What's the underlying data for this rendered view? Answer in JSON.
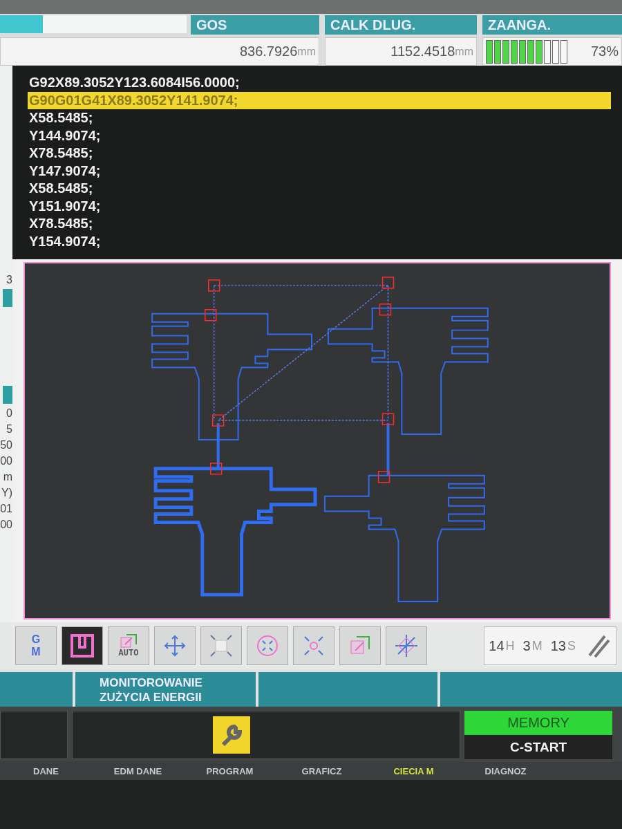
{
  "header": {
    "progress": {
      "level": 0.23
    },
    "panels": [
      {
        "title": "GOS",
        "value": "836.7926",
        "unit": "mm"
      },
      {
        "title": "CALK DLUG.",
        "value": "1152.4518",
        "unit": "mm"
      },
      {
        "title": "ZAANGA.",
        "meter": {
          "level": 0.7
        },
        "value": "73%"
      }
    ]
  },
  "left_strip": [
    "3",
    "0",
    "5",
    "50",
    "00",
    "m",
    "Y)",
    "01",
    "00"
  ],
  "program_lines": [
    {
      "text": "G92X89.3052Y123.6084I56.0000;",
      "selected": false
    },
    {
      "text": "G90G01G41X89.3052Y141.9074;",
      "selected": true
    },
    {
      "text": "X58.5485;",
      "selected": false
    },
    {
      "text": "Y144.9074;",
      "selected": false
    },
    {
      "text": "X78.5485;",
      "selected": false
    },
    {
      "text": "Y147.9074;",
      "selected": false
    },
    {
      "text": "X58.5485;",
      "selected": false
    },
    {
      "text": "Y151.9074;",
      "selected": false
    },
    {
      "text": "X78.5485;",
      "selected": false
    },
    {
      "text": "Y154.9074;",
      "selected": false
    }
  ],
  "toolbar": [
    {
      "kind": "gm",
      "label": "G",
      "sublabel": "M",
      "selected": false
    },
    {
      "kind": "layout",
      "selected": true
    },
    {
      "kind": "auto",
      "label": "AUTO",
      "selected": false
    },
    {
      "kind": "move",
      "selected": false
    },
    {
      "kind": "fit",
      "selected": false
    },
    {
      "kind": "circle",
      "selected": false
    },
    {
      "kind": "zoom",
      "selected": false
    },
    {
      "kind": "copy",
      "selected": false
    },
    {
      "kind": "axes",
      "selected": false
    }
  ],
  "timer": [
    {
      "value": "14",
      "unit": "H"
    },
    {
      "value": "3",
      "unit": "M"
    },
    {
      "value": "13",
      "unit": "S"
    }
  ],
  "softkeys": [
    "MONITOROWANIE ZUŻYCIA ENERGII"
  ],
  "status": {
    "mode": "MEMORY",
    "state": "C-START"
  },
  "tabs": [
    {
      "label": "DANE",
      "selected": false
    },
    {
      "label": "EDM DANE",
      "selected": false
    },
    {
      "label": "PROGRAM",
      "selected": false
    },
    {
      "label": "GRAFICZ",
      "selected": false
    },
    {
      "label": "CIECIA M",
      "selected": true
    },
    {
      "label": "DIAGNOZ",
      "selected": false
    }
  ]
}
